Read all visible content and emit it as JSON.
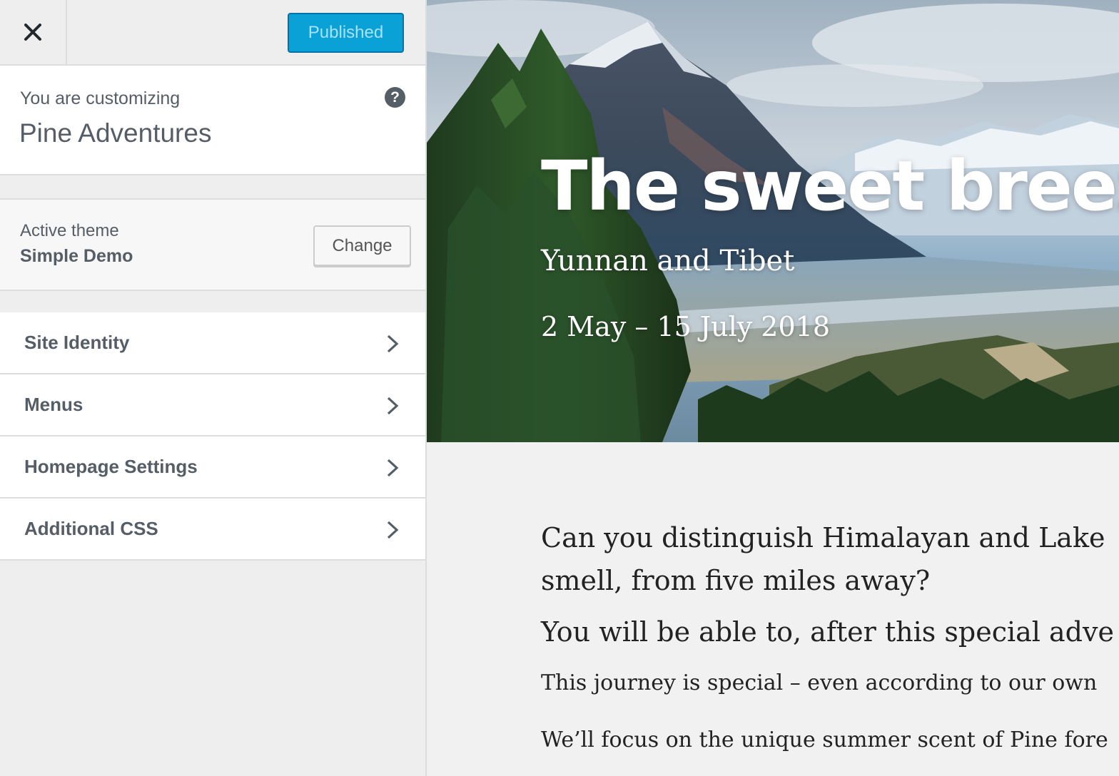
{
  "topbar": {
    "close_label": "×",
    "publish_label": "Published"
  },
  "customizing": {
    "label": "You are customizing",
    "site_title": "Pine Adventures",
    "help_glyph": "?"
  },
  "theme": {
    "label": "Active theme",
    "name": "Simple Demo",
    "change_label": "Change"
  },
  "sections": [
    {
      "title": "Site Identity"
    },
    {
      "title": "Menus"
    },
    {
      "title": "Homepage Settings"
    },
    {
      "title": "Additional CSS"
    }
  ],
  "preview": {
    "hero_title": "The sweet breeze",
    "hero_subtitle": "Yunnan and Tibet",
    "hero_date": "2 May – 15 July 2018",
    "paragraphs": [
      "Can you distinguish Himalayan and Lake",
      "smell, from five miles away?",
      "You will be able to, after this special adve",
      "This journey is special – even according to our own",
      "We’ll focus on the unique summer scent of Pine fore"
    ]
  },
  "colors": {
    "accent": "#0aa1d6",
    "sidebar_bg": "#eeeeee",
    "text_muted": "#555d66"
  },
  "icons": {
    "close": "close-icon",
    "help": "help-icon",
    "chevron": "chevron-right-icon"
  }
}
